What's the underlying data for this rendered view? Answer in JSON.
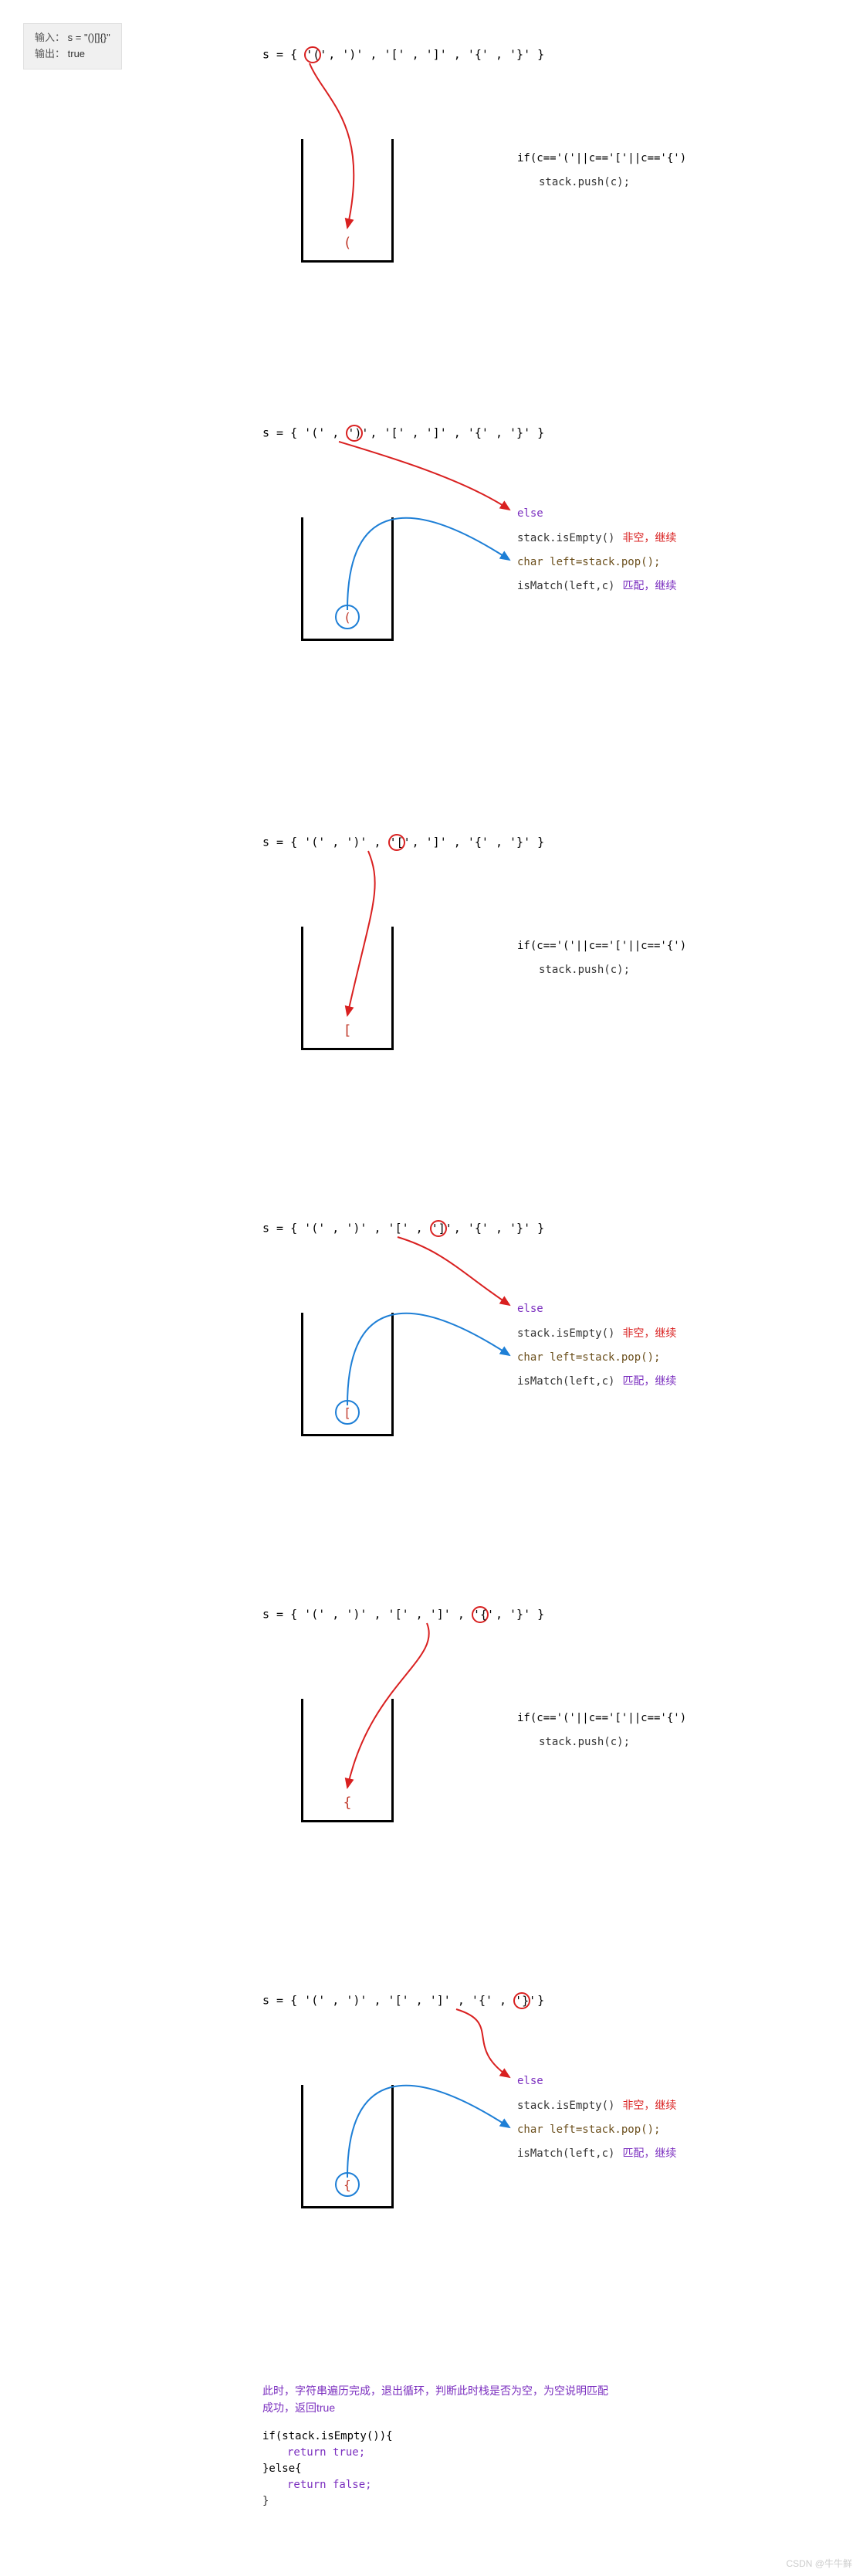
{
  "io": {
    "input_label": "输入：",
    "input_value": "s = \"()[]{}\"",
    "output_label": "输出：",
    "output_value": "true"
  },
  "header_prefix": "s = { ",
  "header_suffix": " }",
  "tokens": [
    "'('",
    "')'",
    "'['",
    "']'",
    "'{'",
    "'}'"
  ],
  "steps": [
    {
      "circle_index": 0,
      "mode": "push",
      "stack_char": "(",
      "code": {
        "if_line": "if(c=='('||c=='['||c=='{')",
        "push_line": "stack.push(c);"
      }
    },
    {
      "circle_index": 1,
      "mode": "pop",
      "stack_char": "(",
      "code": {
        "else_line": "else",
        "empty_line": "stack.isEmpty()",
        "empty_ann": "非空，继续",
        "pop_line": "char left=stack.pop();",
        "match_line": "isMatch(left,c)",
        "match_ann": "匹配，继续"
      }
    },
    {
      "circle_index": 2,
      "mode": "push",
      "stack_char": "[",
      "code": {
        "if_line": "if(c=='('||c=='['||c=='{')",
        "push_line": "stack.push(c);"
      }
    },
    {
      "circle_index": 3,
      "mode": "pop",
      "stack_char": "[",
      "code": {
        "else_line": "else",
        "empty_line": "stack.isEmpty()",
        "empty_ann": "非空，继续",
        "pop_line": "char left=stack.pop();",
        "match_line": "isMatch(left,c)",
        "match_ann": "匹配，继续"
      }
    },
    {
      "circle_index": 4,
      "mode": "push",
      "stack_char": "{",
      "code": {
        "if_line": "if(c=='('||c=='['||c=='{')",
        "push_line": "stack.push(c);"
      }
    },
    {
      "circle_index": 5,
      "mode": "pop",
      "stack_char": "{",
      "code": {
        "else_line": "else",
        "empty_line": "stack.isEmpty()",
        "empty_ann": "非空，继续",
        "pop_line": "char left=stack.pop();",
        "match_line": "isMatch(left,c)",
        "match_ann": "匹配，继续"
      }
    }
  ],
  "final": {
    "text": "此时，字符串遍历完成，退出循环，判断此时栈是否为空，为空说明匹配成功，返回true",
    "code": {
      "l1": "if(stack.isEmpty()){",
      "l2": "return true;",
      "l3": "}else{",
      "l4": "return false;",
      "l5": "}"
    }
  },
  "watermark": "CSDN @牛牛鲜"
}
